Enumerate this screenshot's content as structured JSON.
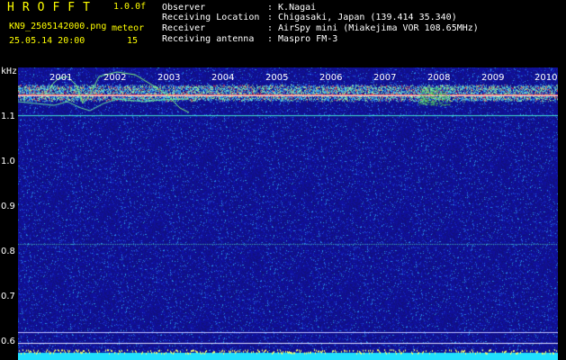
{
  "header": {
    "app_title": "HROFFT",
    "version": "1.0.0f",
    "filename": "KN9_2505142000.png",
    "meteor_label": "meteor",
    "datetime": "25.05.14 20:00",
    "meteor_count": "15",
    "info": [
      {
        "label": "Observer",
        "value": ": K.Nagai"
      },
      {
        "label": "Receiving Location",
        "value": ": Chigasaki, Japan (139.414 35.340)"
      },
      {
        "label": "Receiver",
        "value": ": AirSpy mini (Miakejima VOR 108.65MHz)"
      },
      {
        "label": "Receiving antenna",
        "value": ": Maspro FM-3"
      }
    ]
  },
  "axis": {
    "y_unit": "kHz",
    "y_ticks": [
      "1.1",
      "1.0",
      "0.9",
      "0.8",
      "0.7",
      "0.6"
    ],
    "x_ticks": [
      "2001",
      "2002",
      "2003",
      "2004",
      "2005",
      "2006",
      "2007",
      "2008",
      "2009",
      "2010"
    ]
  },
  "colors": {
    "background": "#000000",
    "spectrogram_base": "#10109a",
    "header_text": "#ffff00",
    "info_text": "#ffffff",
    "carrier_line": "#40e0d0",
    "bottom_band": "#20e0ff"
  }
}
